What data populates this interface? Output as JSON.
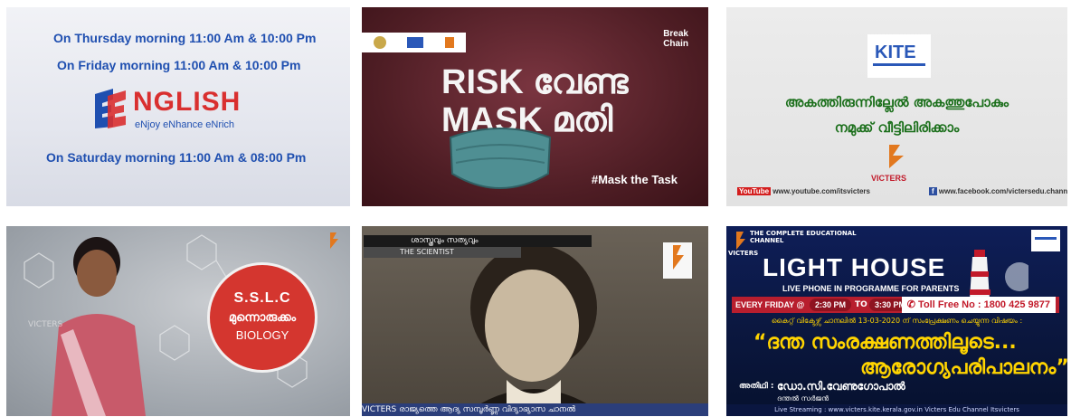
{
  "tile1": {
    "line_thursday": "On Thursday  morning 11:00 Am & 10:00 Pm",
    "line_friday": "On Friday  morning 11:00 Am & 10:00 Pm",
    "logo_word": "NGLISH",
    "logo_sub": "eNjoy  eNhance  eNrich",
    "line_saturday": "On Saturday  morning 11:00 Am & 08:00 Pm"
  },
  "tile2": {
    "line1": "RISK വേണ്ട",
    "line2": "MASK മതി",
    "hashtag": "#Mask the Task",
    "btc_top": "Break",
    "btc_bottom": "Chain"
  },
  "tile3": {
    "line1": "അകത്തിരുന്നില്ലേൽ അകത്തുപോകും",
    "line2": "നമുക്ക് വീട്ടിലിരിക്കാം",
    "brand": "VICTERS",
    "youtube_label": "YouTube",
    "youtube_url": "www.youtube.com/itsvicters",
    "facebook_url": "www.facebook.com/victersedu.channel/"
  },
  "tile4": {
    "line1": "S.S.L.C",
    "line2": "മുന്നൊരുക്കം",
    "line3": "BIOLOGY",
    "watermark": "VICTERS"
  },
  "tile5": {
    "banner_top": "ശാസ്ത്രവും സത്യവും",
    "banner_bottom": "THE SCIENTIST",
    "brand": "VICTERS",
    "ticker": "VICTERS  രാജ്യത്തെ ആദ്യ സമ്പൂർണ്ണ വിദ്യാഭ്യാസ ചാനൽ"
  },
  "tile6": {
    "channel_tag": "THE COMPLETE EDUCATIONAL CHANNEL",
    "brand": "VICTERS",
    "title": "LIGHT HOUSE",
    "subtitle": "LIVE PHONE IN PROGRAMME FOR PARENTS",
    "schedule_day": "EVERY FRIDAY @",
    "time_start": "2:30 PM",
    "time_sep": "TO",
    "time_end": "3:30 PM",
    "toll_free_label": "Toll Free No :",
    "toll_free_number": "1800 425 9877",
    "intro": "കൈറ്റ് വിക്ടേഴ്സ് ചാനലിൽ 13-03-2020 ന് സംപ്രേക്ഷണം ചെയ്യുന്ന വിഷയം :",
    "topic1": "“ദന്ത സംരക്ഷണത്തിലൂടെ...",
    "topic2": "ആരോഗ്യപരിപാലനം”",
    "guest_label": "അതിഥി :",
    "guest_name": "ഡോ.സി.വേണുഗോപാൽ",
    "guest_role": "ദന്തൽ സർജൻ",
    "footer": "Live Streaming : www.victers.kite.kerala.gov.in   Victers Edu Channel   Itsvicters"
  }
}
